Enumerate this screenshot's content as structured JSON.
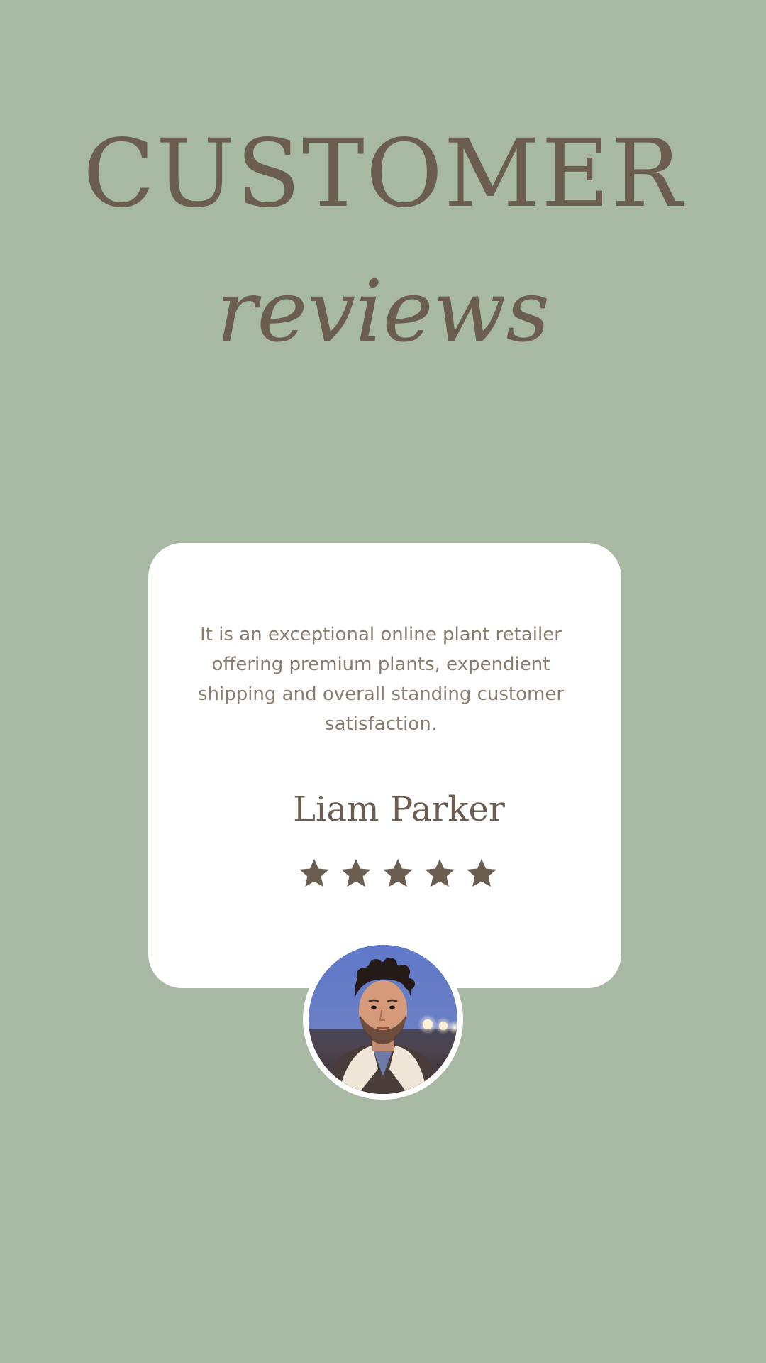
{
  "header": {
    "title": "CUSTOMER",
    "subtitle": "reviews"
  },
  "review": {
    "text": "It is an exceptional online plant retailer offering premium plants, expendient shipping and overall standing customer satisfaction.",
    "reviewer_name": "Liam Parker",
    "rating": 5,
    "rating_max": 5
  },
  "colors": {
    "background": "#a7b8a3",
    "accent": "#6b5e51",
    "card": "#ffffff",
    "body_text": "#8a7c6f"
  },
  "icons": {
    "star": "star-icon",
    "avatar": "reviewer-photo"
  }
}
